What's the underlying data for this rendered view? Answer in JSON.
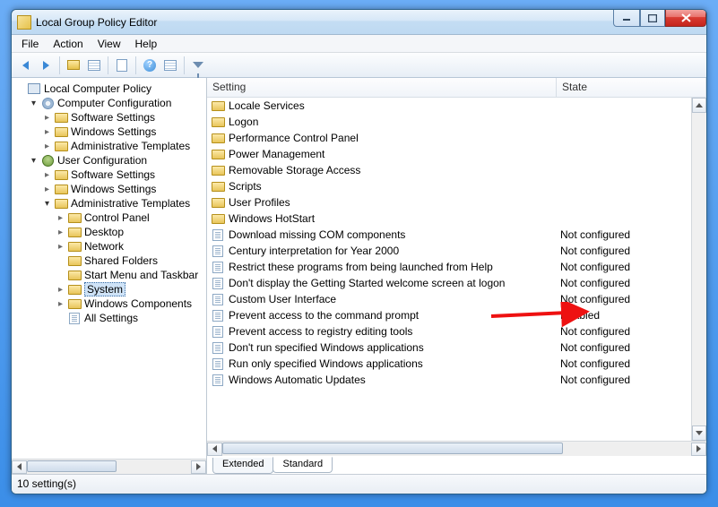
{
  "window": {
    "title": "Local Group Policy Editor"
  },
  "menu": {
    "file": "File",
    "action": "Action",
    "view": "View",
    "help": "Help"
  },
  "tree": {
    "root": "Local Computer Policy",
    "comp_conf": "Computer Configuration",
    "cc_soft": "Software Settings",
    "cc_win": "Windows Settings",
    "cc_admin": "Administrative Templates",
    "user_conf": "User Configuration",
    "uc_soft": "Software Settings",
    "uc_win": "Windows Settings",
    "uc_admin": "Administrative Templates",
    "at_cp": "Control Panel",
    "at_desktop": "Desktop",
    "at_network": "Network",
    "at_shared": "Shared Folders",
    "at_startmenu": "Start Menu and Taskbar",
    "at_system": "System",
    "at_wincomp": "Windows Components",
    "at_all": "All Settings"
  },
  "columns": {
    "setting": "Setting",
    "state": "State"
  },
  "rows": [
    {
      "type": "folder",
      "name": "Locale Services",
      "state": ""
    },
    {
      "type": "folder",
      "name": "Logon",
      "state": ""
    },
    {
      "type": "folder",
      "name": "Performance Control Panel",
      "state": ""
    },
    {
      "type": "folder",
      "name": "Power Management",
      "state": ""
    },
    {
      "type": "folder",
      "name": "Removable Storage Access",
      "state": ""
    },
    {
      "type": "folder",
      "name": "Scripts",
      "state": ""
    },
    {
      "type": "folder",
      "name": "User Profiles",
      "state": ""
    },
    {
      "type": "folder",
      "name": "Windows HotStart",
      "state": ""
    },
    {
      "type": "setting",
      "name": "Download missing COM components",
      "state": "Not configured"
    },
    {
      "type": "setting",
      "name": "Century interpretation for Year 2000",
      "state": "Not configured"
    },
    {
      "type": "setting",
      "name": "Restrict these programs from being launched from Help",
      "state": "Not configured"
    },
    {
      "type": "setting",
      "name": "Don't display the Getting Started welcome screen at logon",
      "state": "Not configured"
    },
    {
      "type": "setting",
      "name": "Custom User Interface",
      "state": "Not configured"
    },
    {
      "type": "setting",
      "name": "Prevent access to the command prompt",
      "state": "Enabled"
    },
    {
      "type": "setting",
      "name": "Prevent access to registry editing tools",
      "state": "Not configured"
    },
    {
      "type": "setting",
      "name": "Don't run specified Windows applications",
      "state": "Not configured"
    },
    {
      "type": "setting",
      "name": "Run only specified Windows applications",
      "state": "Not configured"
    },
    {
      "type": "setting",
      "name": "Windows Automatic Updates",
      "state": "Not configured"
    }
  ],
  "tabs": {
    "extended": "Extended",
    "standard": "Standard"
  },
  "status": "10 setting(s)"
}
